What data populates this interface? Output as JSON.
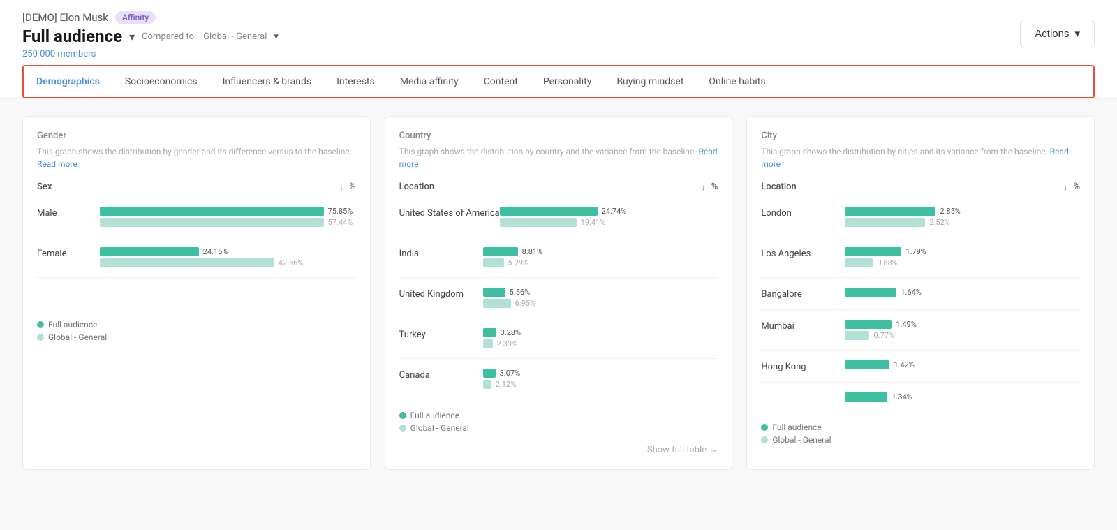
{
  "header": {
    "demo_label": "[DEMO] Elon Musk",
    "badge": "Affinity",
    "audience_title": "Full audience",
    "compared_to_label": "Compared to:",
    "compared_to_value": "Global - General",
    "members_count": "250 000 members",
    "actions_label": "Actions"
  },
  "nav": {
    "tabs": [
      {
        "id": "demographics",
        "label": "Demographics",
        "active": true
      },
      {
        "id": "socioeconomics",
        "label": "Socioeconomics",
        "active": false
      },
      {
        "id": "influencers",
        "label": "Influencers & brands",
        "active": false
      },
      {
        "id": "interests",
        "label": "Interests",
        "active": false
      },
      {
        "id": "media_affinity",
        "label": "Media affinity",
        "active": false
      },
      {
        "id": "content",
        "label": "Content",
        "active": false
      },
      {
        "id": "personality",
        "label": "Personality",
        "active": false
      },
      {
        "id": "buying_mindset",
        "label": "Buying mindset",
        "active": false
      },
      {
        "id": "online_habits",
        "label": "Online habits",
        "active": false
      }
    ]
  },
  "gender_card": {
    "title": "Gender",
    "description": "This graph shows the distribution by gender and its difference versus to the baseline.",
    "read_more": "Read more",
    "col_label": "Sex",
    "col_pct": "%",
    "rows": [
      {
        "label": "Male",
        "primary_pct": "75.85%",
        "primary_width": 75.85,
        "secondary_pct": "57.44%",
        "secondary_width": 57.44
      },
      {
        "label": "Female",
        "primary_pct": "24.15%",
        "primary_width": 24.15,
        "secondary_pct": "42.56%",
        "secondary_width": 42.56
      }
    ],
    "legend_full": "Full audience",
    "legend_global": "Global - General"
  },
  "country_card": {
    "title": "Country",
    "description": "This graph shows the distribution by country and the variance from the baseline.",
    "read_more": "Read more",
    "col_label": "Location",
    "col_pct": "%",
    "rows": [
      {
        "label": "United States of America",
        "primary_pct": "24.74%",
        "primary_width": 90,
        "secondary_pct": "19.41%",
        "secondary_width": 70
      },
      {
        "label": "India",
        "primary_pct": "8.81%",
        "primary_width": 32,
        "secondary_pct": "5.29%",
        "secondary_width": 19
      },
      {
        "label": "United Kingdom",
        "primary_pct": "5.56%",
        "primary_width": 20,
        "secondary_pct": "6.95%",
        "secondary_width": 25
      },
      {
        "label": "Turkey",
        "primary_pct": "3.28%",
        "primary_width": 12,
        "secondary_pct": "2.39%",
        "secondary_width": 9
      },
      {
        "label": "Canada",
        "primary_pct": "3.07%",
        "primary_width": 11,
        "secondary_pct": "2.12%",
        "secondary_width": 8
      }
    ],
    "legend_full": "Full audience",
    "legend_global": "Global - General",
    "show_full_table": "Show full table →"
  },
  "city_card": {
    "title": "City",
    "description": "This graph shows the distribution by cities and its variance from the baseline.",
    "read_more": "Read more",
    "col_label": "Location",
    "col_pct": "%",
    "rows": [
      {
        "label": "London",
        "primary_pct": "2.85%",
        "primary_width": 85,
        "secondary_pct": "2.52%",
        "secondary_width": 75
      },
      {
        "label": "Los Angeles",
        "primary_pct": "1.79%",
        "primary_width": 53,
        "secondary_pct": "0.88%",
        "secondary_width": 26
      },
      {
        "label": "Bangalore",
        "primary_pct": "1.64%",
        "primary_width": 49,
        "secondary_pct": null,
        "secondary_width": 0
      },
      {
        "label": "Mumbai",
        "primary_pct": "1.49%",
        "primary_width": 44,
        "secondary_pct": "0.77%",
        "secondary_width": 23
      },
      {
        "label": "Hong Kong",
        "primary_pct": "1.42%",
        "primary_width": 42,
        "secondary_pct": null,
        "secondary_width": 0
      },
      {
        "label": "",
        "primary_pct": "1.34%",
        "primary_width": 40,
        "secondary_pct": null,
        "secondary_width": 0
      }
    ],
    "legend_full": "Full audience",
    "legend_global": "Global - General"
  }
}
